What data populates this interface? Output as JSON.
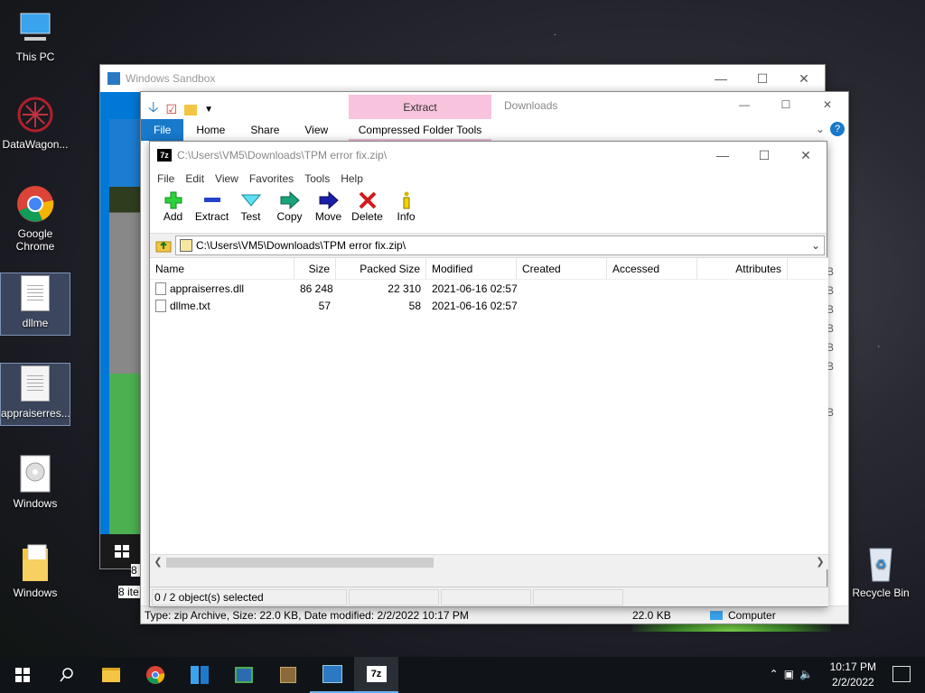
{
  "desktop": {
    "icons": [
      {
        "label": "This PC"
      },
      {
        "label": "DataWagon..."
      },
      {
        "label": "Google Chrome"
      },
      {
        "label": "dllme"
      },
      {
        "label": "appraiserres..."
      },
      {
        "label": "Windows"
      },
      {
        "label": "Windows"
      },
      {
        "label": "Recycle Bin"
      }
    ]
  },
  "sandbox": {
    "title": "Windows Sandbox",
    "partial_status_1": "8 i",
    "partial_status_2": "8 ite"
  },
  "explorer": {
    "tabs": [
      "File",
      "Home",
      "Share",
      "View"
    ],
    "contextual_tab_group": "Extract",
    "contextual_tab": "Compressed Folder Tools",
    "title": "Downloads",
    "status_left": "Type: zip Archive, Size: 22.0 KB, Date modified: 2/2/2022 10:17 PM",
    "status_size": "22.0 KB",
    "status_location": "Computer",
    "right_partial": [
      "B",
      "B",
      "B",
      "B",
      "B",
      "B"
    ],
    "right_partial_header": "B"
  },
  "sevenzip": {
    "title": "C:\\Users\\VM5\\Downloads\\TPM error fix.zip\\",
    "menu": [
      "File",
      "Edit",
      "View",
      "Favorites",
      "Tools",
      "Help"
    ],
    "toolbar": [
      "Add",
      "Extract",
      "Test",
      "Copy",
      "Move",
      "Delete",
      "Info"
    ],
    "address": "C:\\Users\\VM5\\Downloads\\TPM error fix.zip\\",
    "columns": [
      "Name",
      "Size",
      "Packed Size",
      "Modified",
      "Created",
      "Accessed",
      "Attributes"
    ],
    "rows": [
      {
        "name": "appraiserres.dll",
        "size": "86 248",
        "packed": "22 310",
        "modified": "2021-06-16 02:57"
      },
      {
        "name": "dllme.txt",
        "size": "57",
        "packed": "58",
        "modified": "2021-06-16 02:57"
      }
    ],
    "status": "0 / 2 object(s) selected"
  },
  "taskbar": {
    "time": "10:17 PM",
    "date": "2/2/2022"
  },
  "colors": {
    "ribbon_file": "#1979ca",
    "extract": "#f7c3dd",
    "accent": "#0078d7"
  }
}
